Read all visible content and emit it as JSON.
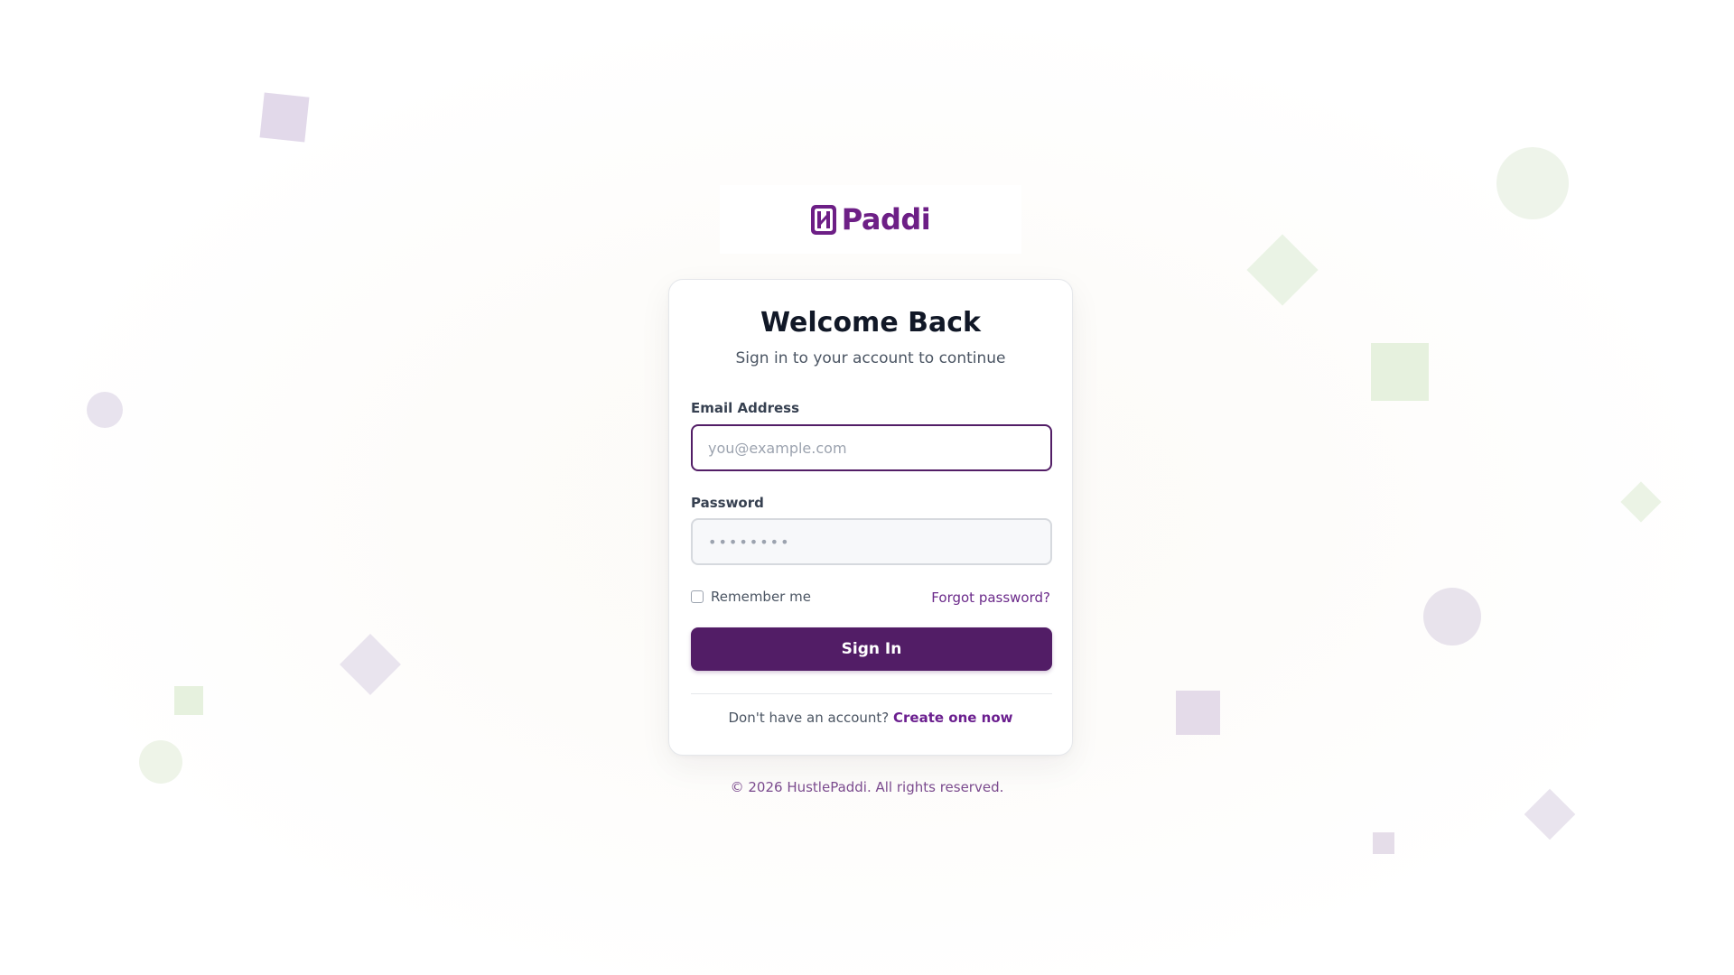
{
  "brand": {
    "name": "Paddi",
    "color": "#6d1f86"
  },
  "login": {
    "title": "Welcome Back",
    "subtitle": "Sign in to your account to continue",
    "email_label": "Email Address",
    "email_placeholder": "you@example.com",
    "email_value": "",
    "password_label": "Password",
    "password_placeholder": "••••••••",
    "password_value": "",
    "remember_label": "Remember me",
    "remember_checked": false,
    "forgot_label": "Forgot password?",
    "signin_label": "Sign In",
    "signup_prompt": "Don't have an account?",
    "signup_link": "Create one now"
  },
  "footer": {
    "copyright": "© 2026 HustlePaddi. All rights reserved."
  },
  "colors": {
    "primary": "#521d66",
    "link": "#6b1f8f",
    "shape_purple": "#e3dbea",
    "shape_green": "#e7f1e0"
  }
}
